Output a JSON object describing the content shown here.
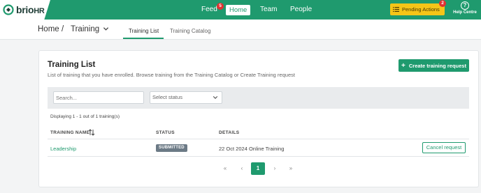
{
  "colors": {
    "brand": "#1f9a6e",
    "pending": "#f5c518",
    "badge": "#e03131",
    "status_badge": "#6c7a86"
  },
  "logo": {
    "brand": "brio",
    "suffix": "HR"
  },
  "nav": {
    "feed": {
      "label": "Feed",
      "badge": "5"
    },
    "home": {
      "label": "Home"
    },
    "team": {
      "label": "Team"
    },
    "people": {
      "label": "People"
    }
  },
  "pending": {
    "label": "Pending Actions",
    "badge": "2",
    "icon": "list-icon"
  },
  "help": {
    "label": "Help Centre",
    "icon": "question-circle-icon"
  },
  "breadcrumb": {
    "home": "Home",
    "separator": "/",
    "current": "Training"
  },
  "subtabs": [
    {
      "label": "Training List",
      "active": true
    },
    {
      "label": "Training Catalog",
      "active": false
    }
  ],
  "card": {
    "title": "Training List",
    "description": "List of training that you have enrolled. Browse training from the Training Catalog or Create Training request",
    "create_button": "Create training request"
  },
  "filters": {
    "search_placeholder": "Search...",
    "status_placeholder": "Select status"
  },
  "displaying": "Displaying 1 - 1 out of 1 training(s)",
  "table": {
    "headers": {
      "name": "TRAINING NAME",
      "status": "STATUS",
      "details": "DETAILS"
    },
    "rows": [
      {
        "name": "Leadership",
        "status": "SUBMITTED",
        "details": "22 Oct 2024 Online Training",
        "action": "Cancel request"
      }
    ]
  },
  "pagination": {
    "first": "«",
    "prev": "‹",
    "current": "1",
    "next": "›",
    "last": "»"
  }
}
